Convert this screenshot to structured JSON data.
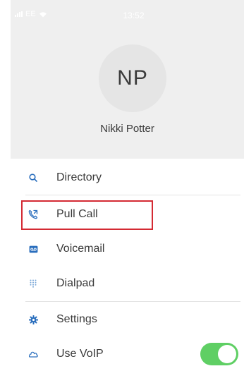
{
  "status_bar": {
    "carrier": "EE",
    "time": "13:52"
  },
  "profile": {
    "initials": "NP",
    "name": "Nikki Potter"
  },
  "menu": {
    "items": [
      {
        "label": "Directory",
        "icon": "search-icon"
      },
      {
        "label": "Pull Call",
        "icon": "phone-transfer-icon"
      },
      {
        "label": "Voicemail",
        "icon": "voicemail-icon"
      },
      {
        "label": "Dialpad",
        "icon": "dialpad-icon"
      },
      {
        "label": "Settings",
        "icon": "gear-icon"
      },
      {
        "label": "Use VoIP",
        "icon": "cloud-icon"
      }
    ]
  },
  "toggles": {
    "use_voip": true
  },
  "colors": {
    "accent_blue": "#2a6ebd",
    "toggle_on": "#5fcf64",
    "highlight_border": "#d42a33",
    "header_bg": "#efefef"
  }
}
